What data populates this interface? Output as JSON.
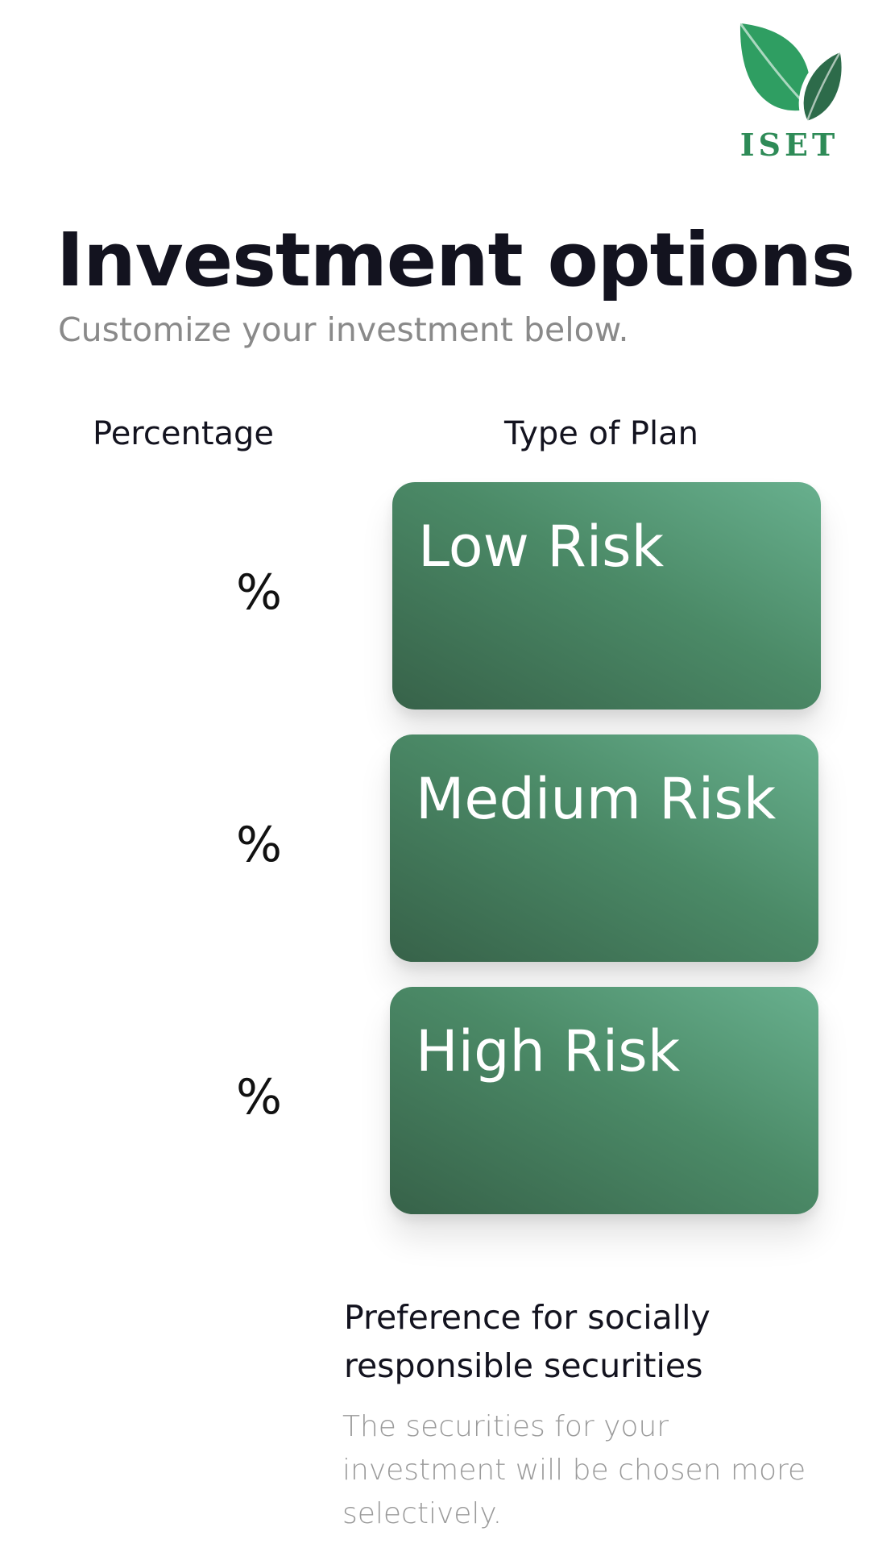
{
  "brand": {
    "name": "ISET",
    "color": "#2e8b57",
    "icon": "leaf-icon"
  },
  "header": {
    "title": "Investment options",
    "subtitle": "Customize your investment below."
  },
  "columns": {
    "percentage_label": "Percentage",
    "plan_label": "Type of Plan"
  },
  "percent_symbol": "%",
  "plans": [
    {
      "label": "Low Risk",
      "percentage_value": ""
    },
    {
      "label": "Medium Risk",
      "percentage_value": ""
    },
    {
      "label": "High Risk",
      "percentage_value": ""
    }
  ],
  "sri": {
    "title": "Preference for socially responsible securities",
    "description": "The securities for your investment will be chosen more selectively."
  },
  "colors": {
    "card_dark": "#376249",
    "card_light": "#68b08e",
    "title_text": "#13131f",
    "muted_text": "#8a8a8a"
  }
}
